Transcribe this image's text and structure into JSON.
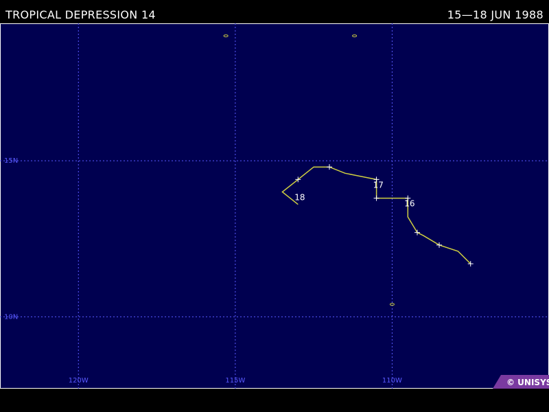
{
  "header": {
    "title": "TROPICAL DEPRESSION 14",
    "date_range": "15—18 JUN 1988"
  },
  "map": {
    "background_color": "#000050",
    "grid_color": "#5a5aff",
    "track_color": "#d0d040",
    "lon_range": [
      -122.5,
      -105.0
    ],
    "lat_range": [
      7.7,
      19.4
    ],
    "lat_lines": [
      {
        "value": 15,
        "label": "15N"
      },
      {
        "value": 10,
        "label": "10N"
      }
    ],
    "lon_lines": [
      {
        "value": -120,
        "label": "120W"
      },
      {
        "value": -115,
        "label": "115W"
      },
      {
        "value": -110,
        "label": "110W"
      }
    ],
    "track": [
      {
        "lon": -107.5,
        "lat": 11.7
      },
      {
        "lon": -107.9,
        "lat": 12.1
      },
      {
        "lon": -108.5,
        "lat": 12.3
      },
      {
        "lon": -109.0,
        "lat": 12.6
      },
      {
        "lon": -109.2,
        "lat": 12.7
      },
      {
        "lon": -109.5,
        "lat": 13.2
      },
      {
        "lon": -109.5,
        "lat": 13.8
      },
      {
        "lon": -110.5,
        "lat": 13.8
      },
      {
        "lon": -110.5,
        "lat": 14.4
      },
      {
        "lon": -111.5,
        "lat": 14.6
      },
      {
        "lon": -112.0,
        "lat": 14.8
      },
      {
        "lon": -112.5,
        "lat": 14.8
      },
      {
        "lon": -113.0,
        "lat": 14.4
      },
      {
        "lon": -113.5,
        "lat": 14.0
      },
      {
        "lon": -113.0,
        "lat": 13.6
      }
    ],
    "tick_points": [
      0,
      2,
      4,
      6,
      7,
      8,
      10,
      12
    ],
    "day_labels": [
      {
        "text": "16",
        "lon": -109.5,
        "lat": 13.8
      },
      {
        "text": "17",
        "lon": -110.5,
        "lat": 14.4
      },
      {
        "text": "18",
        "lon": -113.0,
        "lat": 14.0
      }
    ],
    "islands": [
      {
        "lon": -115.3,
        "lat": 19.0
      },
      {
        "lon": -111.2,
        "lat": 19.0
      },
      {
        "lon": -110.0,
        "lat": 10.4
      }
    ]
  },
  "footer": {
    "badge_text": "© UNISYS",
    "badge_color": "#7a3aa0"
  }
}
